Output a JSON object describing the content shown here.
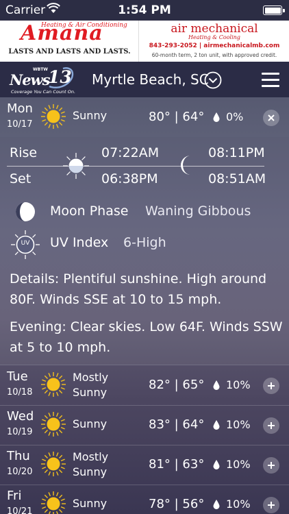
{
  "status_bar": {
    "carrier": "Carrier",
    "time": "1:54 PM"
  },
  "ad": {
    "left_brand": "Amana",
    "left_sub": "Heating & Air Conditioning",
    "left_tagline": "LASTS AND LASTS AND LASTS.",
    "right_company": "air mechanical",
    "right_sub": "Heating & Cooling",
    "right_contact": "843-293-2052 | airmechanicalmb.com",
    "right_terms": "60-month term, 2 ton unit, with approved credit."
  },
  "header": {
    "logo_news": "News",
    "logo_number": "13",
    "logo_call": "WBTW",
    "logo_slogan": "Coverage You Can Count On.",
    "location": "Myrtle Beach, SC"
  },
  "today": {
    "dow": "Mon",
    "date": "10/17",
    "condition": "Sunny",
    "temps": "80° | 64°",
    "precip": "0%",
    "icon": "sun-icon"
  },
  "detail": {
    "rise_label": "Rise",
    "set_label": "Set",
    "sunrise": "07:22AM",
    "sunset": "06:38PM",
    "moonrise": "08:11PM",
    "moonset": "08:51AM",
    "moon_phase_label": "Moon Phase",
    "moon_phase_value": "Waning Gibbous",
    "uv_label": "UV Index",
    "uv_icon_text": "UV",
    "uv_value": "6-High",
    "details_text": "Details: Plentiful sunshine. High around 80F. Winds SSE at 10 to 15 mph.",
    "evening_text": "Evening: Clear skies. Low 64F. Winds SSW at 5 to 10 mph."
  },
  "forecast": [
    {
      "dow": "Tue",
      "date": "10/18",
      "condition": "Mostly Sunny",
      "temps": "82° | 65°",
      "precip": "10%"
    },
    {
      "dow": "Wed",
      "date": "10/19",
      "condition": "Sunny",
      "temps": "83° | 64°",
      "precip": "10%"
    },
    {
      "dow": "Thu",
      "date": "10/20",
      "condition": "Mostly Sunny",
      "temps": "81° | 63°",
      "precip": "10%"
    },
    {
      "dow": "Fri",
      "date": "10/21",
      "condition": "Sunny",
      "temps": "78° | 56°",
      "precip": "10%"
    }
  ],
  "colors": {
    "sun": "#f7c21b",
    "header_bg": "#2b2c46",
    "ad_red": "#e01b22"
  }
}
